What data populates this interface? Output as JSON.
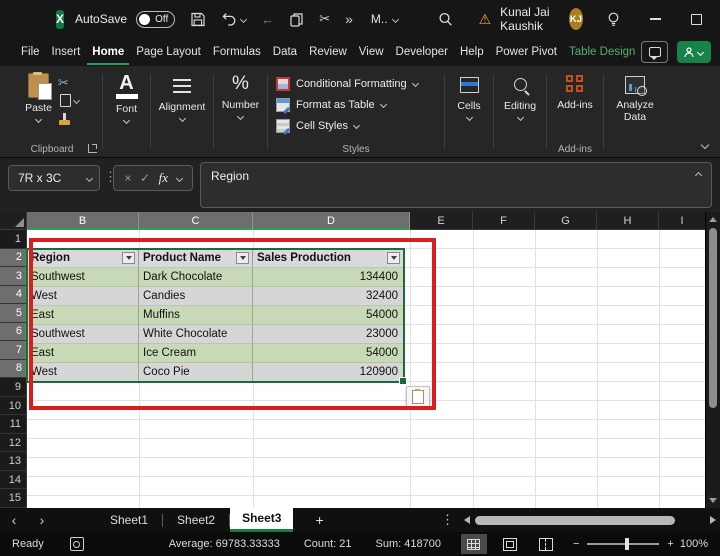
{
  "titlebar": {
    "logo_letter": "X",
    "autosave_label": "AutoSave",
    "autosave_state": "Off",
    "doc_menu_label": "M..",
    "user_name": "Kunal Jai Kaushik",
    "user_initials": "KJ"
  },
  "icons": {
    "back_arrow": "←",
    "overflow": "»",
    "scissors": "✂",
    "warning": "⚠",
    "dots_vertical": "⋮",
    "prev_sheet": "‹",
    "next_sheet": "›"
  },
  "menubar": {
    "tabs": [
      "File",
      "Insert",
      "Home",
      "Page Layout",
      "Formulas",
      "Data",
      "Review",
      "View",
      "Developer",
      "Help",
      "Power Pivot",
      "Table Design"
    ]
  },
  "ribbon": {
    "paste": "Paste",
    "clipboard_group": "Clipboard",
    "font": "Font",
    "font_icon_letter": "A",
    "alignment": "Alignment",
    "number": "Number",
    "number_icon": "%",
    "conditional_formatting": "Conditional Formatting",
    "format_as_table": "Format as Table",
    "cell_styles": "Cell Styles",
    "styles_group": "Styles",
    "cells": "Cells",
    "editing": "Editing",
    "addins": "Add-ins",
    "addins_group": "Add-ins",
    "analyze_line1": "Analyze",
    "analyze_line2": "Data"
  },
  "formula_bar": {
    "name_box": "7R x 3C",
    "cancel": "×",
    "enter": "✓",
    "fx": "fx",
    "content": "Region"
  },
  "grid": {
    "columns": [
      "B",
      "C",
      "D",
      "E",
      "F",
      "G",
      "H",
      "I"
    ],
    "rows": [
      "1",
      "2",
      "3",
      "4",
      "5",
      "6",
      "7",
      "8",
      "9",
      "10",
      "11",
      "12",
      "13",
      "14",
      "15"
    ],
    "table": {
      "headers": [
        "Region",
        "Product Name",
        "Sales Production"
      ],
      "data": [
        [
          "Southwest",
          "Dark Chocolate",
          "134400"
        ],
        [
          "West",
          "Candies",
          "32400"
        ],
        [
          "East",
          "Muffins",
          "54000"
        ],
        [
          "Southwest",
          "White Chocolate",
          "23000"
        ],
        [
          "East",
          "Ice Cream",
          "54000"
        ],
        [
          "West",
          "Coco Pie",
          "120900"
        ]
      ]
    }
  },
  "sheet_bar": {
    "tabs": [
      "Sheet1",
      "Sheet2",
      "Sheet3"
    ],
    "active_tab": "Sheet3",
    "add_sheet": "+"
  },
  "status_bar": {
    "mode": "Ready",
    "average": "Average: 69783.33333",
    "count": "Count: 21",
    "sum": "Sum: 418700",
    "zoom_out": "−",
    "zoom_in": "+",
    "zoom_level": "100%"
  },
  "colors": {
    "excel_green": "#107c41",
    "tab_underline_green": "#2e9e5b",
    "selection_green": "#1a6b3c",
    "band_green": "#c8d9b6",
    "band_gray": "#d6d6d6",
    "table_header_fill": "#d9d9d9",
    "annotation_red": "#d81f1f",
    "avatar_gold": "#a97f1f",
    "addins_orange": "#c0501f"
  }
}
